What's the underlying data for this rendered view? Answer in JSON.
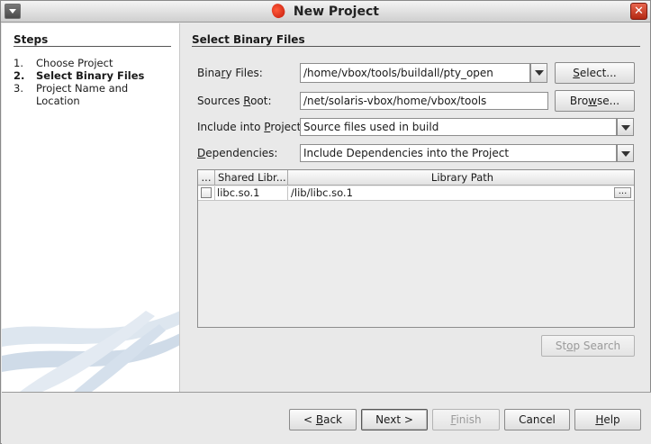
{
  "window": {
    "title": "New Project",
    "close_glyph": "✕"
  },
  "steps": {
    "heading": "Steps",
    "items": [
      {
        "num": "1.",
        "label": "Choose Project",
        "current": false
      },
      {
        "num": "2.",
        "label": "Select Binary Files",
        "current": true
      },
      {
        "num": "3.",
        "label": "Project Name and Location",
        "current": false
      }
    ]
  },
  "section": {
    "title": "Select Binary Files"
  },
  "form": {
    "binary_files": {
      "label_pre": "Bina",
      "label_mn": "r",
      "label_post": "y Files:",
      "value": "/home/vbox/tools/buildall/pty_open"
    },
    "sources_root": {
      "label_pre": "Sources ",
      "label_mn": "R",
      "label_post": "oot:",
      "value": "/net/solaris-vbox/home/vbox/tools"
    },
    "include": {
      "label_pre": "Include into ",
      "label_mn": "P",
      "label_post": "roject",
      "value": "Source files used in build"
    },
    "dependencies": {
      "label_pre": "",
      "label_mn": "D",
      "label_post": "ependencies:",
      "value": "Include Dependencies into the Project"
    },
    "select_btn": {
      "pre": "",
      "mn": "S",
      "post": "elect..."
    },
    "browse_btn": {
      "pre": "Bro",
      "mn": "w",
      "post": "se..."
    }
  },
  "table": {
    "columns": [
      "...",
      "Shared Libr...",
      "Library Path"
    ],
    "rows": [
      {
        "checked": false,
        "library": "libc.so.1",
        "path": "/lib/libc.so.1",
        "action": "..."
      }
    ]
  },
  "stop_search": {
    "pre": "St",
    "mn": "o",
    "post": "p Search"
  },
  "buttons": {
    "back": {
      "pre": "< ",
      "mn": "B",
      "post": "ack"
    },
    "next": {
      "pre": "Next >",
      "mn": "",
      "post": ""
    },
    "finish": {
      "pre": "",
      "mn": "F",
      "post": "inish"
    },
    "cancel": {
      "pre": "Cancel",
      "mn": "",
      "post": ""
    },
    "help": {
      "pre": "",
      "mn": "H",
      "post": "elp"
    }
  },
  "colors": {
    "accent_swoosh": "#c9d7e6",
    "title_logo": "#d8271a",
    "close_button": "#c8361f"
  },
  "icons": {
    "window_menu": "chevron-down-icon",
    "close": "close-icon",
    "logo": "solaris-logo-icon"
  }
}
